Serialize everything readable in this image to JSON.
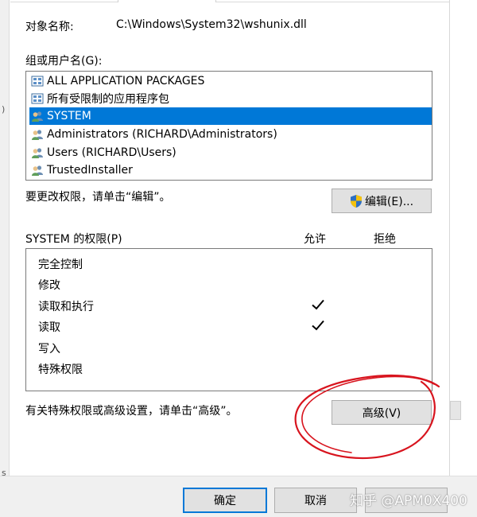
{
  "object": {
    "label": "对象名称:",
    "value": "C:\\Windows\\System32\\wshunix.dll"
  },
  "groups": {
    "label": "组或用户名(G):",
    "items": [
      {
        "name": "ALL APPLICATION PACKAGES",
        "icon": "package-icon",
        "selected": false
      },
      {
        "name": "所有受限制的应用程序包",
        "icon": "package-icon",
        "selected": false
      },
      {
        "name": "SYSTEM",
        "icon": "users-icon",
        "selected": true
      },
      {
        "name": "Administrators (RICHARD\\Administrators)",
        "icon": "users-icon",
        "selected": false
      },
      {
        "name": "Users (RICHARD\\Users)",
        "icon": "users-icon",
        "selected": false
      },
      {
        "name": "TrustedInstaller",
        "icon": "users-icon",
        "selected": false
      }
    ],
    "selected_color": "#0078d7"
  },
  "edit_hint": "要更改权限，请单击“编辑”。",
  "edit_button": "编辑(E)...",
  "permissions": {
    "label": "SYSTEM 的权限(P)",
    "allow_header": "允许",
    "deny_header": "拒绝",
    "rows": [
      {
        "name": "完全控制",
        "allow": false,
        "deny": false
      },
      {
        "name": "修改",
        "allow": false,
        "deny": false
      },
      {
        "name": "读取和执行",
        "allow": true,
        "deny": false
      },
      {
        "name": "读取",
        "allow": true,
        "deny": false
      },
      {
        "name": "写入",
        "allow": false,
        "deny": false
      },
      {
        "name": "特殊权限",
        "allow": false,
        "deny": false
      }
    ]
  },
  "advanced_hint": "有关特殊权限或高级设置，请单击“高级”。",
  "advanced_button": "高级(V)",
  "footer": {
    "ok": "确定",
    "cancel": "取消"
  },
  "watermark": "知乎 @APM0X400",
  "annotation_color": "#d8141e"
}
